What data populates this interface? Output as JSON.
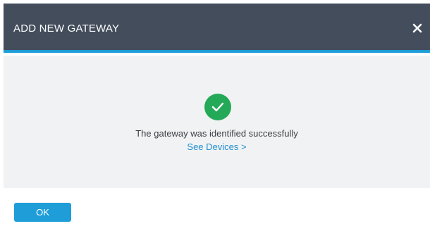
{
  "dialog": {
    "title": "ADD NEW GATEWAY",
    "close_icon": "close-icon",
    "status_icon": "check-circle-icon",
    "message": "The gateway was identified successfully",
    "link_text": "See Devices >",
    "ok_label": "OK"
  },
  "colors": {
    "header_bg": "#434d5c",
    "accent": "#1e9dd8",
    "success": "#23a957",
    "body_bg": "#f1f2f3",
    "link": "#1e8fcf"
  }
}
